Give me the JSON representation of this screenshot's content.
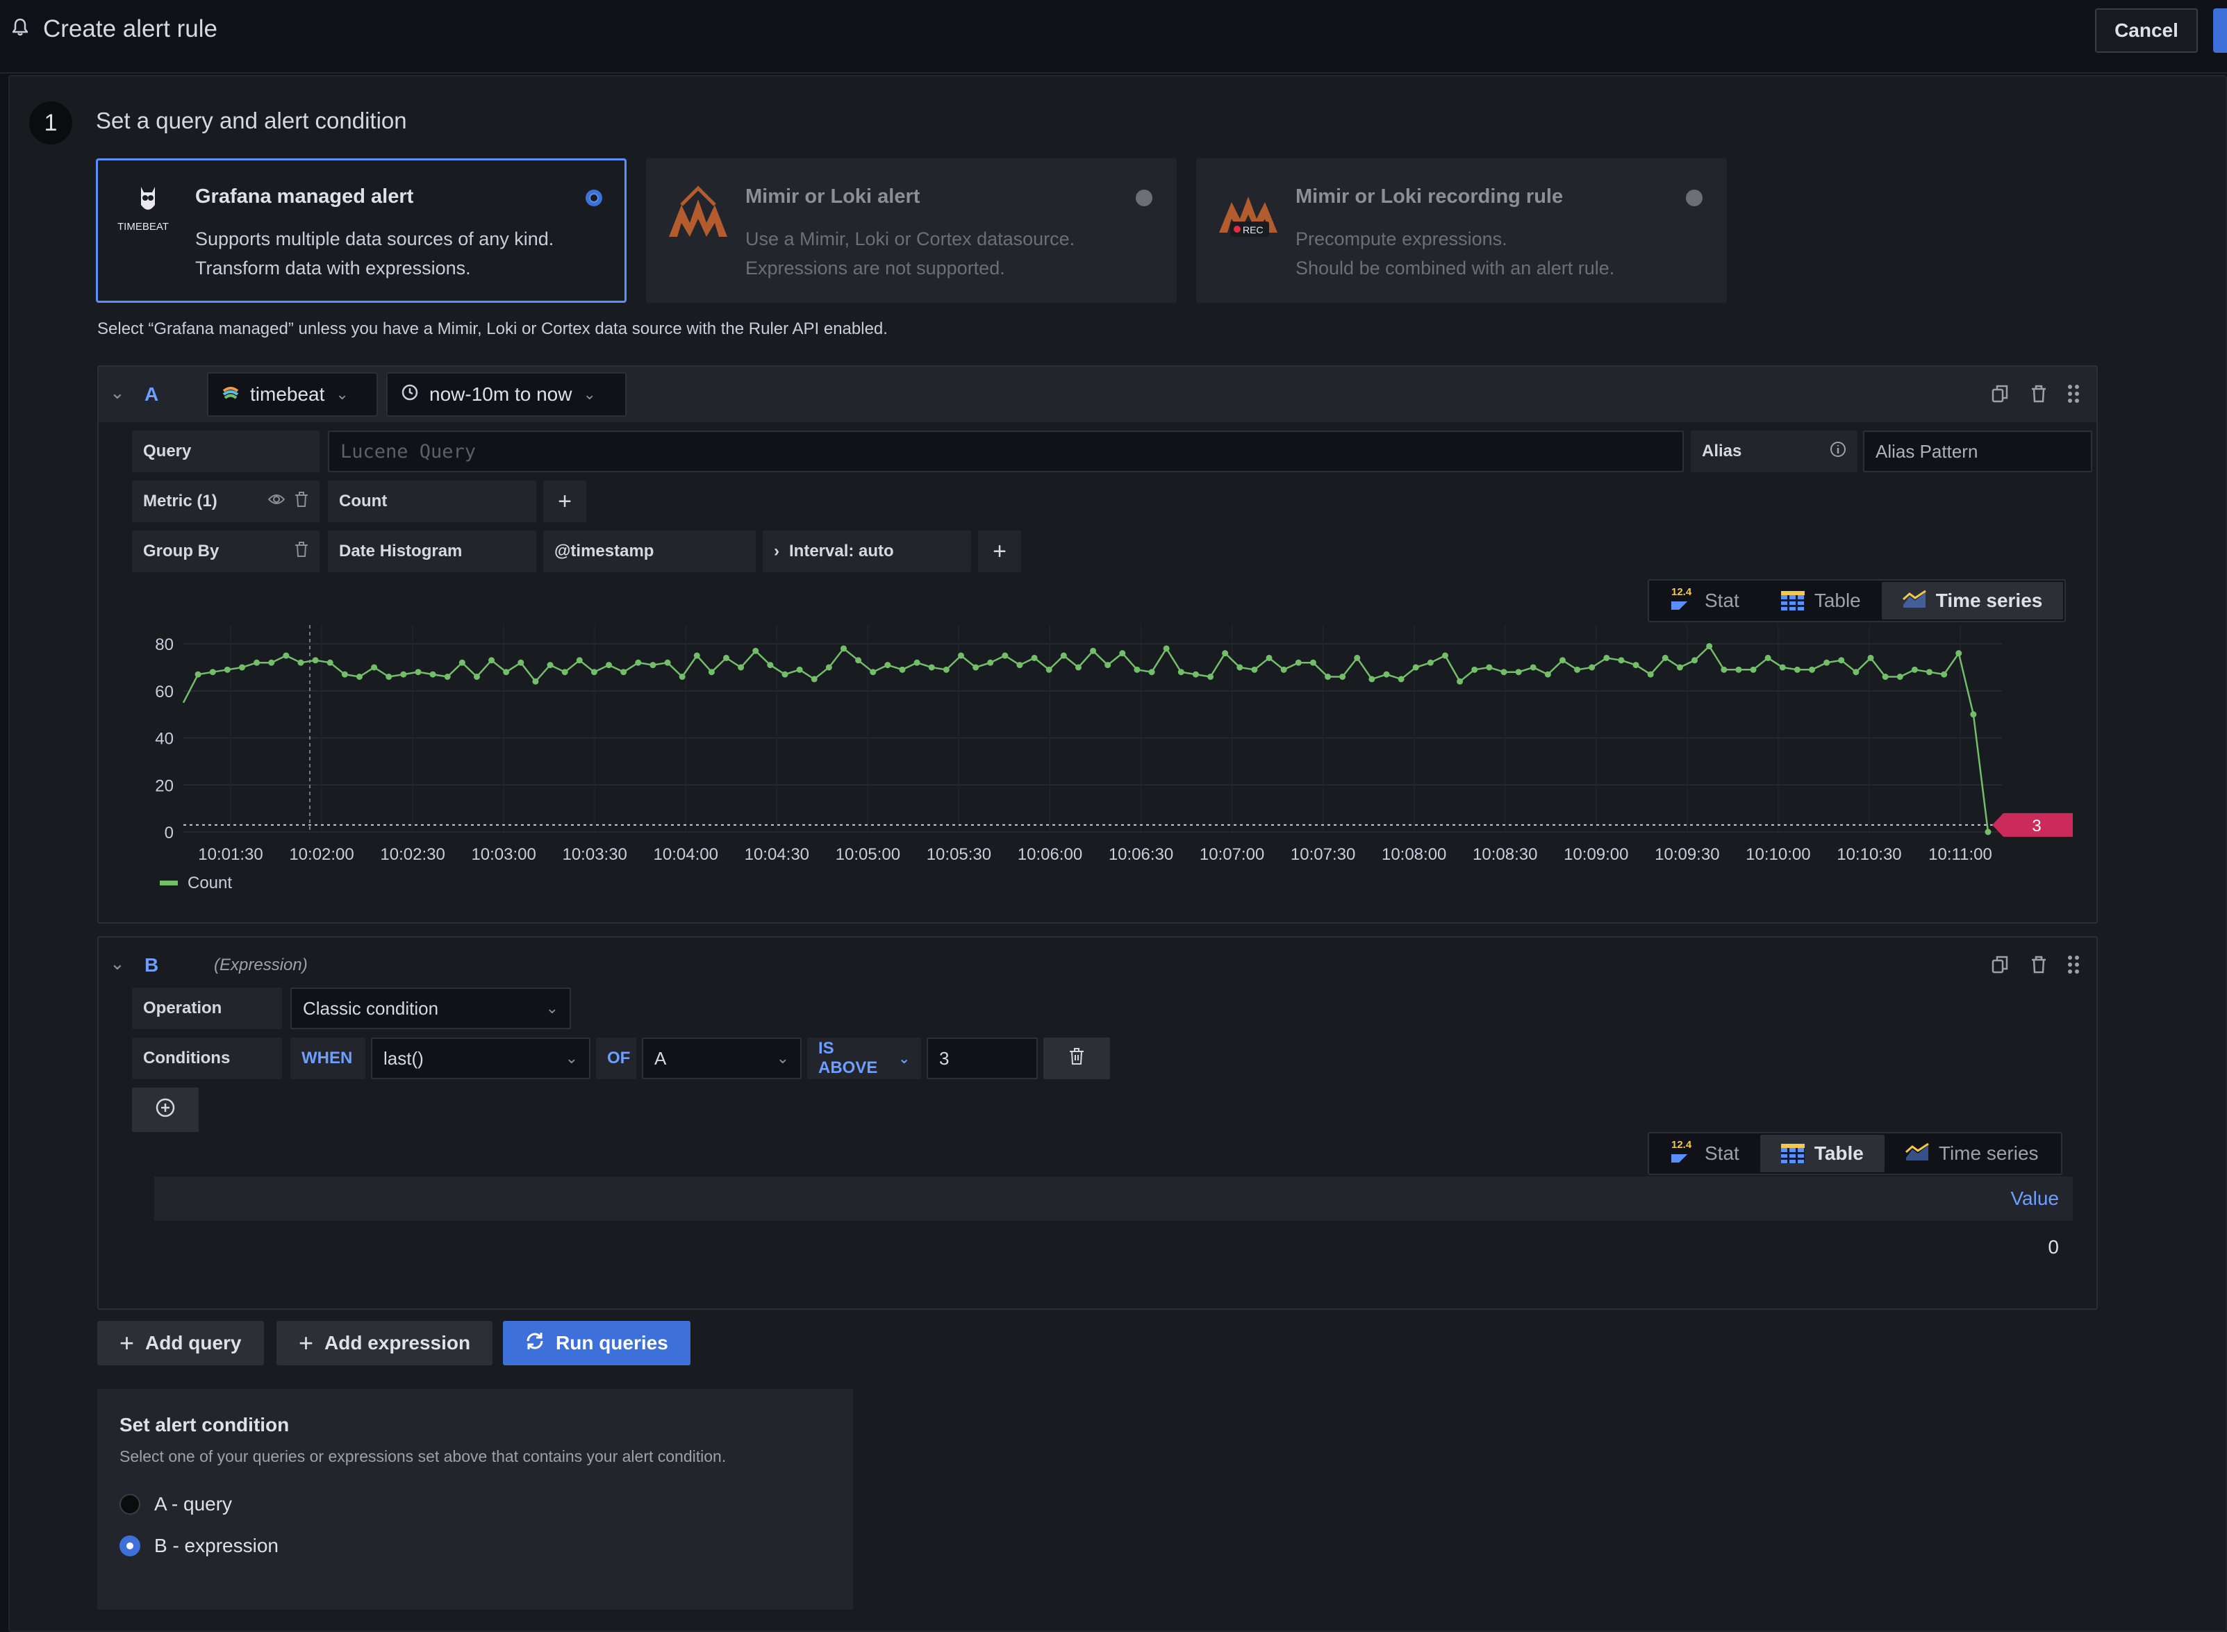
{
  "header": {
    "title": "Create alert rule",
    "cancel_label": "Cancel"
  },
  "step": {
    "number": "1",
    "title": "Set a query and alert condition"
  },
  "rule_types": [
    {
      "title": "Grafana managed alert",
      "desc1": "Supports multiple data sources of any kind.",
      "desc2": "Transform data with expressions.",
      "logo_text": "TIMEBEAT",
      "selected": true
    },
    {
      "title": "Mimir or Loki alert",
      "desc1": "Use a Mimir, Loki or Cortex datasource.",
      "desc2": "Expressions are not supported.",
      "selected": false
    },
    {
      "title": "Mimir or Loki recording rule",
      "desc1": "Precompute expressions.",
      "desc2": "Should be combined with an alert rule.",
      "logo_badge": "REC",
      "selected": false
    }
  ],
  "hint": "Select “Grafana managed” unless you have a Mimir, Loki or Cortex data source with the Ruler API enabled.",
  "query_a": {
    "ref": "A",
    "datasource": "timebeat",
    "time_range": "now-10m to now",
    "query_label": "Query",
    "query_placeholder": "Lucene Query",
    "alias_label": "Alias",
    "alias_placeholder": "Alias Pattern",
    "metric_label": "Metric (1)",
    "metric_value": "Count",
    "groupby_label": "Group By",
    "groupby_value": "Date Histogram",
    "groupby_field": "@timestamp",
    "interval": "Interval: auto",
    "viz_tabs": [
      "Stat",
      "Table",
      "Time series"
    ],
    "active_tab": "Time series"
  },
  "chart_data": {
    "type": "line",
    "series": [
      {
        "name": "Count",
        "color": "#73bf69",
        "values": [
          55,
          67,
          68,
          69,
          70,
          72,
          72,
          75,
          72,
          73,
          72,
          67,
          66,
          70,
          66,
          67,
          68,
          67,
          66,
          72,
          66,
          73,
          68,
          72,
          64,
          71,
          68,
          73,
          68,
          71,
          68,
          72,
          71,
          72,
          66,
          75,
          68,
          74,
          70,
          77,
          71,
          67,
          69,
          65,
          70,
          78,
          73,
          68,
          71,
          69,
          72,
          70,
          69,
          75,
          70,
          72,
          75,
          71,
          74,
          69,
          75,
          70,
          77,
          71,
          76,
          69,
          68,
          78,
          68,
          67,
          66,
          76,
          70,
          69,
          74,
          69,
          72,
          72,
          66,
          66,
          74,
          65,
          67,
          65,
          70,
          72,
          75,
          64,
          69,
          70,
          68,
          68,
          70,
          67,
          73,
          69,
          70,
          74,
          73,
          71,
          67,
          74,
          70,
          73,
          79,
          69,
          69,
          69,
          74,
          70,
          69,
          69,
          72,
          73,
          68,
          74,
          66,
          66,
          69,
          68,
          67,
          76,
          50,
          0
        ]
      }
    ],
    "x_ticks": [
      "10:01:30",
      "10:02:00",
      "10:02:30",
      "10:03:00",
      "10:03:30",
      "10:04:00",
      "10:04:30",
      "10:05:00",
      "10:05:30",
      "10:06:00",
      "10:06:30",
      "10:07:00",
      "10:07:30",
      "10:08:00",
      "10:08:30",
      "10:09:00",
      "10:09:30",
      "10:10:00",
      "10:10:30",
      "10:11:00"
    ],
    "y_ticks": [
      "0",
      "20",
      "40",
      "60",
      "80"
    ],
    "ylim": [
      0,
      88
    ],
    "threshold": 3,
    "threshold_label": "3",
    "threshold_color": "#cc2a5a",
    "legend": "Count",
    "grid": true,
    "xlabel": "",
    "ylabel": ""
  },
  "query_b": {
    "ref": "B",
    "type_label": "(Expression)",
    "operation_label": "Operation",
    "operation_value": "Classic condition",
    "conditions_label": "Conditions",
    "when": "WHEN",
    "reducer": "last()",
    "of": "OF",
    "of_query": "A",
    "evaluator": "IS ABOVE",
    "threshold": "3",
    "viz_tabs": [
      "Stat",
      "Table",
      "Time series"
    ],
    "active_tab": "Table",
    "table_header": "Value",
    "table_value": "0"
  },
  "actions": {
    "add_query": "Add query",
    "add_expression": "Add expression",
    "run_queries": "Run queries"
  },
  "condition": {
    "title": "Set alert condition",
    "desc": "Select one of your queries or expressions set above that contains your alert condition.",
    "options": [
      {
        "label": "A - query",
        "selected": false
      },
      {
        "label": "B - expression",
        "selected": true
      }
    ]
  }
}
